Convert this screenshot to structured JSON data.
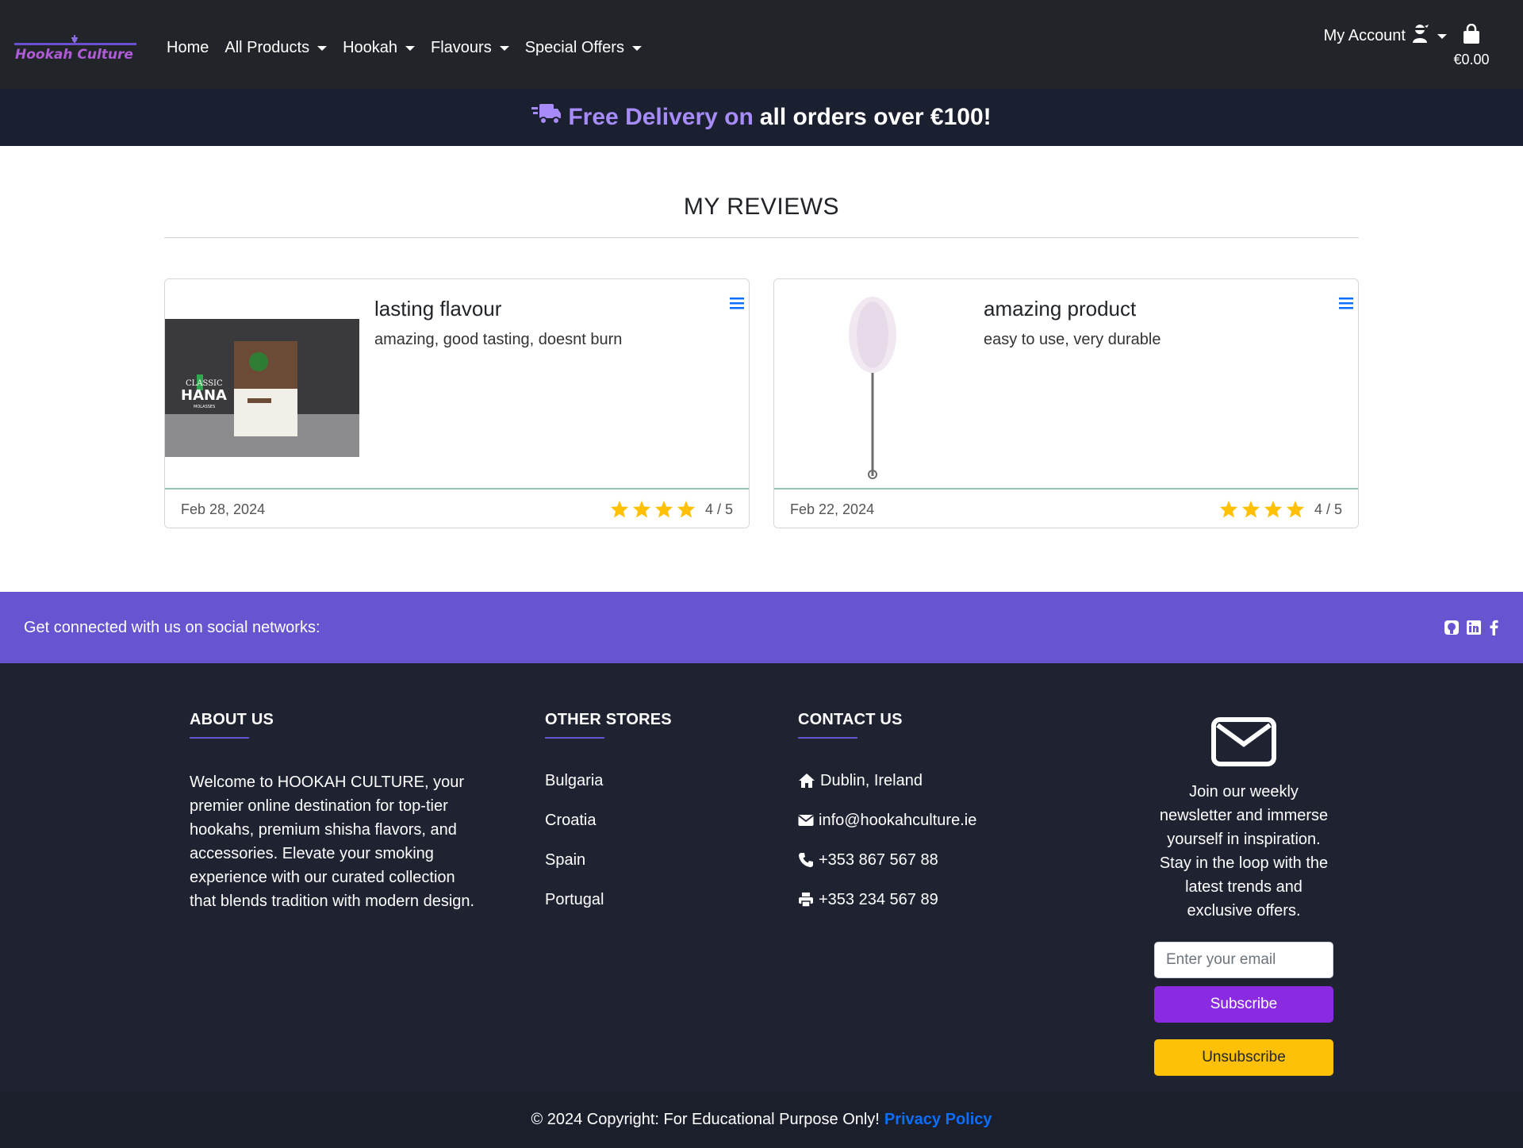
{
  "nav": {
    "logo_text": "Hookah Culture",
    "links": [
      {
        "label": "Home",
        "dropdown": false
      },
      {
        "label": "All Products",
        "dropdown": true
      },
      {
        "label": "Hookah",
        "dropdown": true
      },
      {
        "label": "Flavours",
        "dropdown": true
      },
      {
        "label": "Special Offers",
        "dropdown": true
      }
    ],
    "account_label": "My Account",
    "account_icon": "user-ninja-icon",
    "cart_icon": "shopping-bag-icon",
    "cart_total": "€0.00"
  },
  "banner": {
    "icon": "truck-fast-icon",
    "accent_text": "Free Delivery on",
    "rest_text": "all orders over €100!",
    "accent_color": "#a78bfa"
  },
  "page": {
    "title": "MY REVIEWS"
  },
  "reviews": [
    {
      "title": "lasting flavour",
      "text": "amazing, good tasting, doesnt burn",
      "date": "Feb 28, 2024",
      "rating": 4,
      "rating_text": "4 / 5",
      "image_label": "CLASSIC HANA MOLASSES"
    },
    {
      "title": "amazing product",
      "text": "easy to use, very durable",
      "date": "Feb 22, 2024",
      "rating": 4,
      "rating_text": "4 / 5",
      "image_label": ""
    }
  ],
  "social": {
    "text": "Get connected with us on social networks:",
    "icons": [
      "github-icon",
      "linkedin-icon",
      "facebook-icon"
    ],
    "bg_color": "#6654d1"
  },
  "footer": {
    "about": {
      "heading": "ABOUT US",
      "text": "Welcome to HOOKAH CULTURE, your premier online destination for top-tier hookahs, premium shisha flavors, and accessories. Elevate your smoking experience with our curated collection that blends tradition with modern design."
    },
    "stores": {
      "heading": "OTHER STORES",
      "items": [
        "Bulgaria",
        "Croatia",
        "Spain",
        "Portugal"
      ]
    },
    "contact": {
      "heading": "CONTACT US",
      "address": "Dublin, Ireland",
      "email": "info@hookahculture.ie",
      "phone": "+353 867 567 88",
      "fax": "+353 234 567 89"
    },
    "newsletter": {
      "icon": "envelope-icon",
      "text": "Join our weekly newsletter and immerse yourself in inspiration. Stay in the loop with the latest trends and exclusive offers.",
      "placeholder": "Enter your email",
      "subscribe_label": "Subscribe",
      "unsubscribe_label": "Unsubscribe"
    },
    "copyright": "© 2024 Copyright: For Educational Purpose Only!",
    "privacy_label": "Privacy Policy"
  }
}
